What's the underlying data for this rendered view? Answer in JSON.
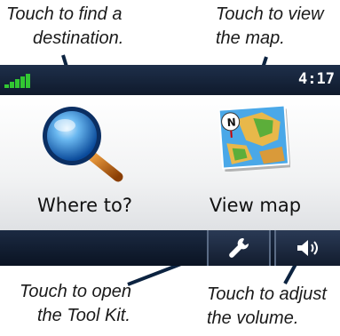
{
  "callouts": {
    "find": {
      "line1": "Touch to find a",
      "line2": "destination."
    },
    "view": {
      "line1": "Touch to view",
      "line2": "the map."
    },
    "tool": {
      "line1": "Touch to open",
      "line2": "the Tool Kit."
    },
    "volume": {
      "line1": "Touch to adjust",
      "line2": "the volume."
    }
  },
  "status_bar": {
    "time": "4:17",
    "signal_icon": "satellite-signal-icon"
  },
  "menu": {
    "where_to": {
      "label": "Where to?",
      "icon": "magnifier-icon"
    },
    "view_map": {
      "label": "View map",
      "icon": "map-icon"
    }
  },
  "toolbar": {
    "tools": {
      "icon": "wrench-icon"
    },
    "volume": {
      "icon": "speaker-icon"
    }
  },
  "colors": {
    "leader_lines": "#0c2340",
    "status_bar": "#1e2f4a",
    "signal_bars": "#32c832"
  }
}
